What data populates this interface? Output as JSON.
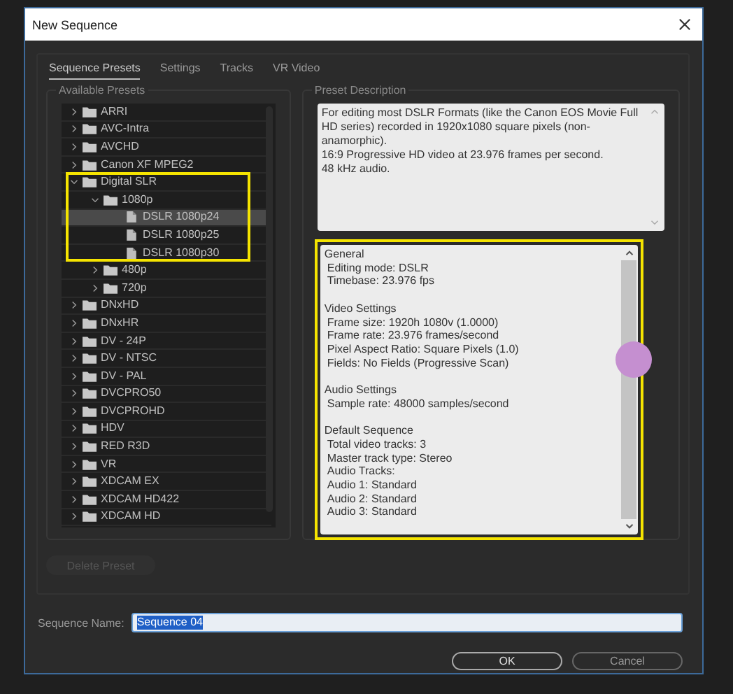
{
  "window": {
    "title": "New Sequence"
  },
  "tabs": [
    {
      "label": "Sequence Presets",
      "selected": true
    },
    {
      "label": "Settings",
      "selected": false
    },
    {
      "label": "Tracks",
      "selected": false
    },
    {
      "label": "VR Video",
      "selected": false
    }
  ],
  "available_presets": {
    "title": "Available Presets",
    "items": [
      {
        "label": "ARRI",
        "kind": "folder",
        "expanded": false,
        "selected": false
      },
      {
        "label": "AVC-Intra",
        "kind": "folder",
        "expanded": false,
        "selected": false
      },
      {
        "label": "AVCHD",
        "kind": "folder",
        "expanded": false,
        "selected": false
      },
      {
        "label": "Canon XF MPEG2",
        "kind": "folder",
        "expanded": false,
        "selected": false
      },
      {
        "label": "Digital SLR",
        "kind": "folder",
        "expanded": true,
        "selected": false,
        "children": [
          {
            "label": "1080p",
            "kind": "folder",
            "expanded": true,
            "selected": false,
            "children": [
              {
                "label": "DSLR 1080p24",
                "kind": "preset",
                "selected": true
              },
              {
                "label": "DSLR 1080p25",
                "kind": "preset",
                "selected": false
              },
              {
                "label": "DSLR 1080p30",
                "kind": "preset",
                "selected": false
              }
            ]
          },
          {
            "label": "480p",
            "kind": "folder",
            "expanded": false,
            "selected": false
          },
          {
            "label": "720p",
            "kind": "folder",
            "expanded": false,
            "selected": false
          }
        ]
      },
      {
        "label": "DNxHD",
        "kind": "folder",
        "expanded": false,
        "selected": false
      },
      {
        "label": "DNxHR",
        "kind": "folder",
        "expanded": false,
        "selected": false
      },
      {
        "label": "DV - 24P",
        "kind": "folder",
        "expanded": false,
        "selected": false
      },
      {
        "label": "DV - NTSC",
        "kind": "folder",
        "expanded": false,
        "selected": false
      },
      {
        "label": "DV - PAL",
        "kind": "folder",
        "expanded": false,
        "selected": false
      },
      {
        "label": "DVCPRO50",
        "kind": "folder",
        "expanded": false,
        "selected": false
      },
      {
        "label": "DVCPROHD",
        "kind": "folder",
        "expanded": false,
        "selected": false
      },
      {
        "label": "HDV",
        "kind": "folder",
        "expanded": false,
        "selected": false
      },
      {
        "label": "RED R3D",
        "kind": "folder",
        "expanded": false,
        "selected": false
      },
      {
        "label": "VR",
        "kind": "folder",
        "expanded": false,
        "selected": false
      },
      {
        "label": "XDCAM EX",
        "kind": "folder",
        "expanded": false,
        "selected": false
      },
      {
        "label": "XDCAM HD422",
        "kind": "folder",
        "expanded": false,
        "selected": false
      },
      {
        "label": "XDCAM HD",
        "kind": "folder",
        "expanded": false,
        "selected": false
      }
    ],
    "delete_button": {
      "label": "Delete Preset",
      "disabled": true
    }
  },
  "preset_description": {
    "title": "Preset Description",
    "paragraphs": [
      "For editing most DSLR Formats (like the Canon EOS Movie Full HD series) recorded in 1920x1080 square pixels (non-anamorphic).",
      "16:9 Progressive HD video at 23.976 frames per second.",
      "48 kHz audio."
    ]
  },
  "details": {
    "sections": [
      {
        "heading": "General",
        "lines": [
          "Editing mode: DSLR",
          "Timebase: 23.976 fps"
        ]
      },
      {
        "heading": "Video Settings",
        "lines": [
          "Frame size: 1920h 1080v (1.0000)",
          "Frame rate: 23.976  frames/second",
          "Pixel Aspect Ratio: Square Pixels (1.0)",
          "Fields: No Fields (Progressive Scan)"
        ]
      },
      {
        "heading": "Audio Settings",
        "lines": [
          "Sample rate: 48000 samples/second"
        ]
      },
      {
        "heading": "Default Sequence",
        "lines": [
          "Total video tracks: 3",
          "Master track type: Stereo",
          "Audio Tracks:",
          "Audio 1: Standard",
          "Audio 2: Standard",
          "Audio 3: Standard"
        ]
      }
    ]
  },
  "sequence_name": {
    "label": "Sequence Name:",
    "value": "Sequence 04"
  },
  "buttons": [
    {
      "label": "OK",
      "kind": "default"
    },
    {
      "label": "Cancel",
      "kind": "normal"
    }
  ]
}
